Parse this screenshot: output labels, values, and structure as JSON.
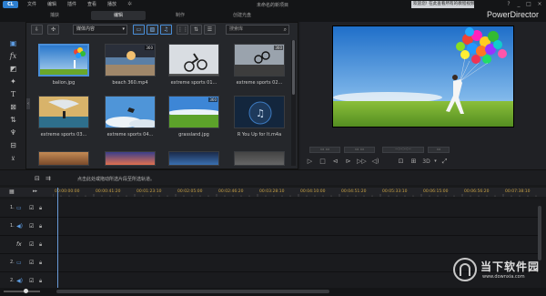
{
  "titlebar": {
    "logo": "CL",
    "menus": [
      "文件",
      "编辑",
      "插件",
      "查看",
      "播放"
    ],
    "project_title": "未命名的新项目",
    "notice": "欢迎您! 在此查看所有的教程视频!",
    "window_buttons": [
      "?",
      "_",
      "□",
      "×"
    ]
  },
  "modes": {
    "tabs": [
      "捕获",
      "编辑",
      "制作",
      "创建光盘"
    ],
    "active": "编辑",
    "brand": "PowerDirector"
  },
  "library": {
    "filter_label": "媒体内容",
    "search_placeholder": "搜索库",
    "items": [
      {
        "label": "balion.jpg",
        "badge": "",
        "thumb": "balloon"
      },
      {
        "label": "beach 360.mp4",
        "badge": "360",
        "thumb": "beach"
      },
      {
        "label": "extreme sports 01...",
        "badge": "",
        "thumb": "bmx"
      },
      {
        "label": "extreme sports 02...",
        "badge": "360",
        "thumb": "bmx2"
      },
      {
        "label": "extreme sports 03...",
        "badge": "",
        "thumb": "kite"
      },
      {
        "label": "extreme sports 04...",
        "badge": "",
        "thumb": "sky"
      },
      {
        "label": "grassland.jpg",
        "badge": "360",
        "thumb": "grass"
      },
      {
        "label": "R You Up for It.m4a",
        "badge": "",
        "thumb": "music"
      }
    ]
  },
  "preview": {
    "timecode": "--:--:--:--",
    "mode_label": "3D"
  },
  "timeline": {
    "hint": "点击此处或拖动所选片段至所选轨道。",
    "ruler": [
      "00:00:00:00",
      "00:00:41:20",
      "00:01:23:10",
      "00:02:05:00",
      "00:02:46:20",
      "00:03:28:10",
      "00:04:10:00",
      "00:04:51:20",
      "00:05:33:10",
      "00:06:15:00",
      "00:06:56:20",
      "00:07:38:10"
    ],
    "tracks": [
      {
        "num": "1.",
        "icon": "video-track-icon",
        "glyph": "▭"
      },
      {
        "num": "1.",
        "icon": "audio-track-icon",
        "glyph": "◀)"
      },
      {
        "num": "",
        "icon": "fx-track-icon",
        "glyph": "fx"
      },
      {
        "num": "2.",
        "icon": "video-track-icon",
        "glyph": "▭"
      },
      {
        "num": "2.",
        "icon": "audio-track-icon",
        "glyph": "◀)"
      }
    ]
  },
  "watermark": {
    "title": "当下软件园",
    "url": "www.downxia.com"
  },
  "colors": {
    "accent": "#4a8fd9",
    "ruler": "#c9a245",
    "bg": "#1c1d20"
  }
}
